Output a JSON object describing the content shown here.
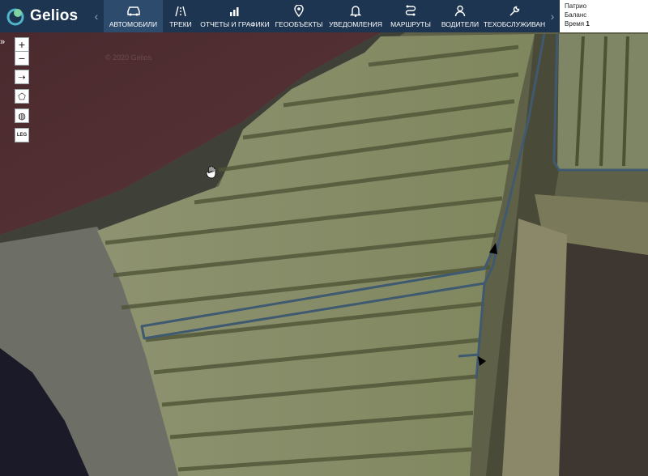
{
  "app": {
    "logo_text": "Gelios"
  },
  "nav": {
    "prev_arrow": "‹",
    "next_arrow": "›",
    "items": [
      {
        "label": "Автомобили",
        "icon": "car-icon",
        "active": true
      },
      {
        "label": "Треки",
        "icon": "road-icon"
      },
      {
        "label": "Отчеты и графики",
        "icon": "chart-icon"
      },
      {
        "label": "Геообъекты",
        "icon": "map-pin-icon"
      },
      {
        "label": "Уведомления",
        "icon": "bell-icon"
      },
      {
        "label": "Маршруты",
        "icon": "route-icon"
      },
      {
        "label": "Водители",
        "icon": "user-icon"
      },
      {
        "label": "Техобслуживан",
        "icon": "wrench-icon"
      }
    ]
  },
  "status": {
    "line1": "Патрио",
    "line2": "Баланс",
    "time_label": "Время",
    "time_value": "1"
  },
  "map_tools": {
    "zoom_in": "+",
    "zoom_out": "−",
    "measure": "⇢",
    "polygon": "⬠",
    "layers": "◍",
    "legend": "LEG"
  },
  "expand_label": "»",
  "watermark": "© 2020 Gelios",
  "colors": {
    "topbar": "#1d3550",
    "active_tab": "#2d4c6d",
    "track": "#3f5a70"
  }
}
